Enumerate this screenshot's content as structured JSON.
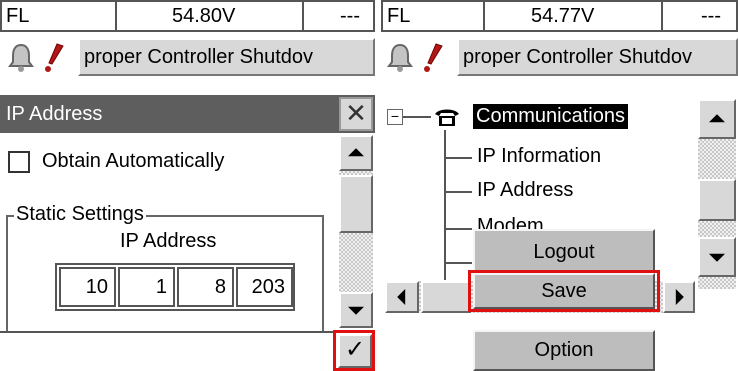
{
  "left": {
    "status": {
      "mode": "FL",
      "voltage": "54.80V",
      "extra": "---"
    },
    "banner": "proper Controller Shutdov",
    "dialog": {
      "title": "IP Address",
      "close_glyph": "✕",
      "obtain_label": "Obtain Automatically",
      "group_label": "Static Settings",
      "ip_label": "IP Address",
      "octets": [
        "10",
        "1",
        "8",
        "203"
      ],
      "confirm_glyph": "✓"
    }
  },
  "right": {
    "status": {
      "mode": "FL",
      "voltage": "54.77V",
      "extra": "---"
    },
    "banner": "proper Controller Shutdov",
    "tree": {
      "expander": "−",
      "root": "Communications",
      "children": [
        "IP Information",
        "IP Address",
        "Modem"
      ]
    },
    "menu": {
      "items": [
        "Logout",
        "Save",
        "Option"
      ]
    }
  },
  "colors": {
    "highlight": "#e01010",
    "titlebar": "#5e5e5e",
    "button_face": "#d8d8d8",
    "menu_face": "#bdbdbd"
  }
}
